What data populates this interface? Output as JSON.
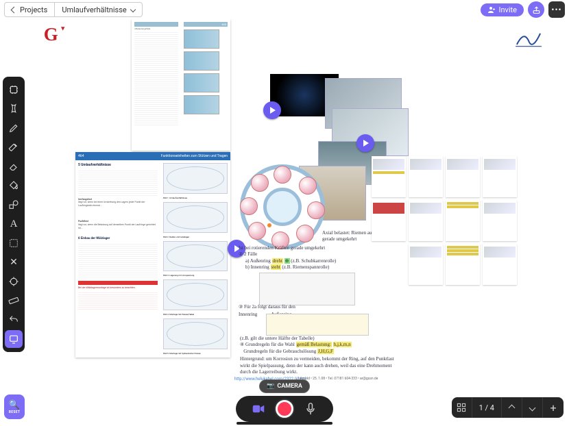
{
  "topbar": {
    "back_label": "Projects",
    "doc_title": "Umlaufverhältnisse",
    "invite_label": "Invite"
  },
  "tools": [
    {
      "id": "frame",
      "name": "frame-tool"
    },
    {
      "id": "pointer",
      "name": "pointer-tool"
    },
    {
      "id": "pencil",
      "name": "pencil-tool"
    },
    {
      "id": "highlighter",
      "name": "highlighter-tool"
    },
    {
      "id": "eraser",
      "name": "eraser-tool"
    },
    {
      "id": "fill",
      "name": "fill-tool"
    },
    {
      "id": "shapes",
      "name": "shapes-tool"
    },
    {
      "id": "text",
      "name": "text-tool"
    },
    {
      "id": "lasso",
      "name": "lasso-tool"
    },
    {
      "id": "cut",
      "name": "cut-tool"
    },
    {
      "id": "target",
      "name": "target-tool"
    },
    {
      "id": "ruler",
      "name": "ruler-tool"
    },
    {
      "id": "undo",
      "name": "undo-tool"
    },
    {
      "id": "present",
      "name": "present-tool"
    }
  ],
  "reset_label": "RESET",
  "camera_label": "CAMERA",
  "nav": {
    "page_label": "1 / 4"
  },
  "page1": {
    "header_left": "464",
    "header_right": "Funktionseinheiten zum Stützen und Tragen",
    "section_title": "5 Umlaufverhältnisse",
    "para1": "Bei nicht vorliegenden Wälzlagern, die als Loslager wirken sollen, muss ein Laufring axial verschiebbar sein...",
    "bold1": "Umfangslast",
    "para2": "liegt vor, wenn bei einer Umdrehung des Lagers jeder Punkt der Laufringbahn einmal...",
    "bold2": "Punktlast",
    "para3": "liegt vor, wenn die Belastung auf denselben Punkt der Laufringe gerichtet ist...",
    "sub1": "6 Einbau der Wälzlager",
    "para4": "Zwischen den Wälzkörpern und den Lagerringen ist meist ein geringes Spiel enthalten...",
    "redbox": "Bei der Wälzlagermontage ist besonders zu beachten:",
    "bullets": [
      "Wälzlager sind sehr empfindlich gegen Verschmutzung.",
      "Wälzlager sollen immer in der Originalverpackung aufbewahrt werden."
    ],
    "fig_caps": [
      "Bild 1: Umlaufverhältnisse",
      "Bild 2: Radial- und Axiallager",
      "Bild 3: Lagerung mit Vorspannung",
      "Bild 4: Montage mit Presse/Hebel",
      "Bild 5: Montage mit hydraulischer Presse"
    ]
  },
  "page_top": {
    "header_right": "Funktionseinheiten zum Stützen und Tragen",
    "header_page": "463",
    "section": "4 Belastungsfälle"
  },
  "notes": {
    "n1": "Axial belastet: Riemen aufgrund oder gerade umgekehrt",
    "n2_line1": "Ist bei rotierenden Kräften gerade umgekehrt",
    "n2_cases": "2 Fälle",
    "n2_a": "a) Außenring",
    "n2_a_tag": "dreht",
    "n2_a_ex": "(z.B. Schubkarrenrolle)",
    "n2_b": "b) Innenring",
    "n2_b_tag": "steht",
    "n2_b_ex": "(z.B. Riemenspannrolle)",
    "n3": "Für 2a folgt daraus für den",
    "n3_l": "Innenring",
    "n3_r": "Außenring",
    "n4_line1": "(z.B. gilt die untere Hälfte der Tabelle)",
    "n4_line2a": "Grundregeln für die Wahl",
    "n4_line2b": "gemäß Belastung:",
    "n4_code1": "h,j,k,m,n",
    "n4_line3a": "Grundregeln für die Gebrauchslösung",
    "n4_code2": "J,H,G,F",
    "n4_line4": "Hintergrund: um Korrosion zu vermeiden, bekommt der Ring, auf den Punktlast wirkt die Spielpassung, denn der kann auch drehen, weil das eine Drehmoment durch die Lagerreibung wirkt."
  },
  "footer": {
    "link": "http://www.helukabel.com/2322.0.html",
    "meta": "J. Arnold • 25. 1.08 • Tel. 07181 604-333 • ar@gssn.de"
  }
}
